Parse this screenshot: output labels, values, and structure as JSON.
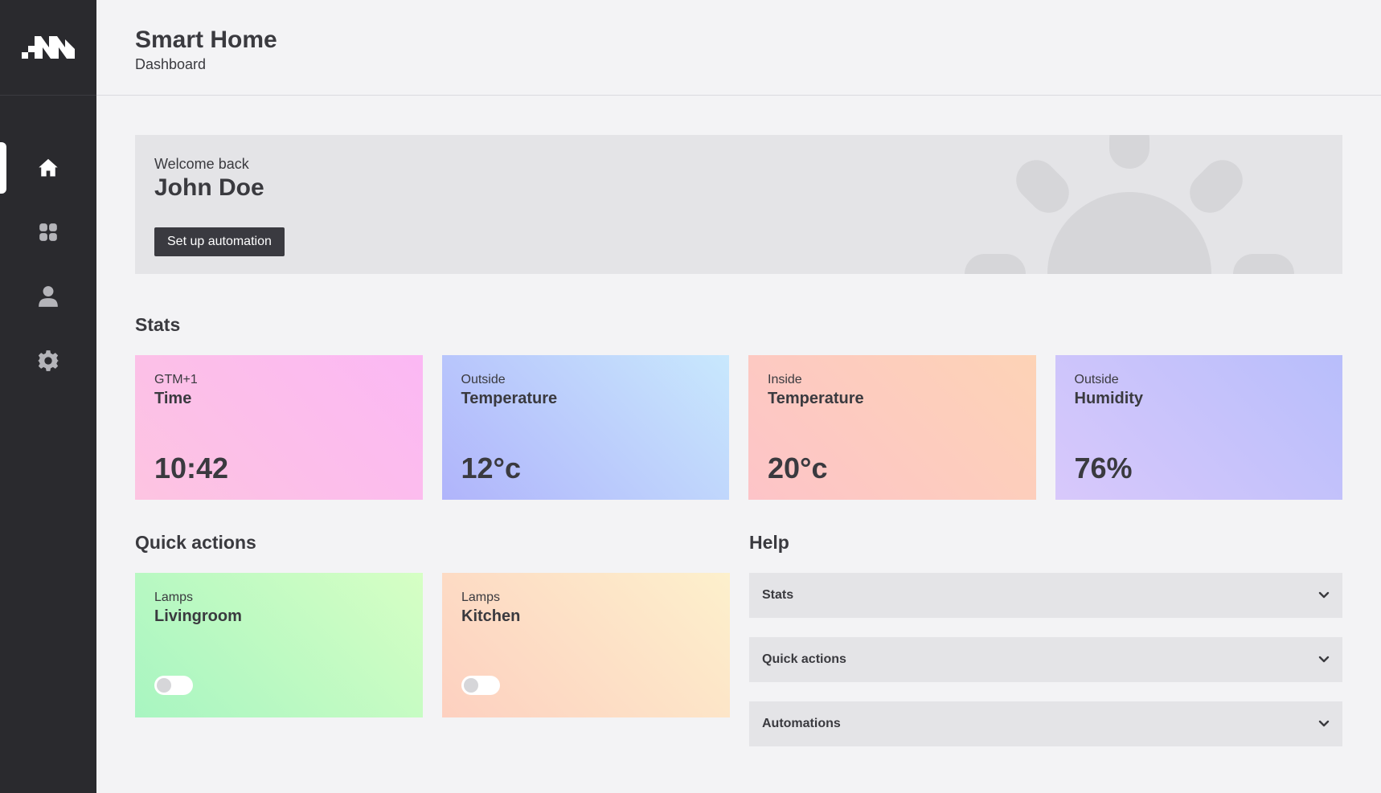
{
  "app": {
    "title": "Smart Home",
    "subtitle": "Dashboard"
  },
  "sidebar": {
    "items": [
      {
        "name": "home",
        "icon": "home-icon",
        "active": true
      },
      {
        "name": "apps",
        "icon": "grid-icon",
        "active": false
      },
      {
        "name": "profile",
        "icon": "user-icon",
        "active": false
      },
      {
        "name": "settings",
        "icon": "gear-icon",
        "active": false
      }
    ]
  },
  "welcome": {
    "greeting": "Welcome back",
    "name": "John Doe",
    "button_label": "Set up automation"
  },
  "stats": {
    "title": "Stats",
    "cards": [
      {
        "small": "GTM+1",
        "big": "Time",
        "value": "10:42"
      },
      {
        "small": "Outside",
        "big": "Temperature",
        "value": "12°c"
      },
      {
        "small": "Inside",
        "big": "Temperature",
        "value": "20°c"
      },
      {
        "small": "Outside",
        "big": "Humidity",
        "value": "76%"
      }
    ]
  },
  "quick_actions": {
    "title": "Quick actions",
    "cards": [
      {
        "small": "Lamps",
        "big": "Livingroom",
        "on": false
      },
      {
        "small": "Lamps",
        "big": "Kitchen",
        "on": false
      }
    ]
  },
  "help": {
    "title": "Help",
    "items": [
      {
        "label": "Stats"
      },
      {
        "label": "Quick actions"
      },
      {
        "label": "Automations"
      }
    ]
  },
  "colors": {
    "sidebar_bg": "#2a2a2e",
    "page_bg": "#f3f3f5",
    "button_bg": "#3a3a40",
    "text": "#3a3a3f"
  }
}
